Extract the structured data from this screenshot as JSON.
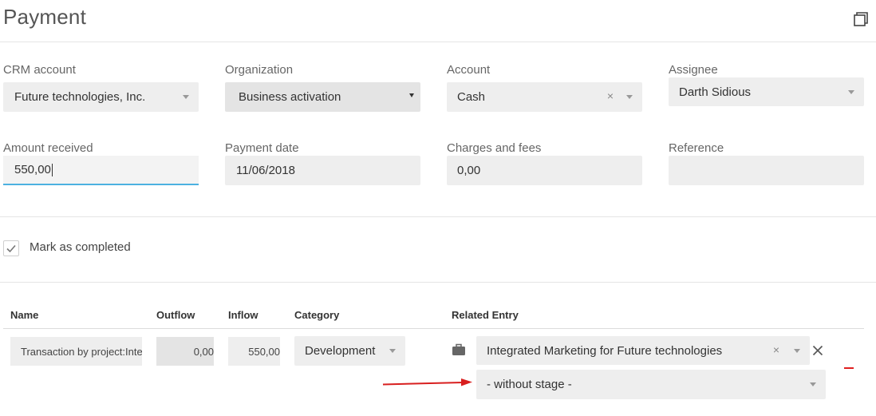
{
  "page": {
    "title": "Payment"
  },
  "fields": {
    "crm_account": {
      "label": "CRM account",
      "value": "Future technologies, Inc."
    },
    "organization": {
      "label": "Organization",
      "value": "Business activation"
    },
    "account": {
      "label": "Account",
      "value": "Cash",
      "clear": "×"
    },
    "assignee": {
      "label": "Assignee",
      "value": "Darth Sidious"
    },
    "amount_received": {
      "label": "Amount received",
      "value": "550,00"
    },
    "payment_date": {
      "label": "Payment date",
      "value": "11/06/2018"
    },
    "charges_fees": {
      "label": "Charges and fees",
      "value": "0,00"
    },
    "reference": {
      "label": "Reference",
      "value": ""
    }
  },
  "mark_completed": {
    "label": "Mark as completed",
    "checked": true
  },
  "table": {
    "headers": {
      "name": "Name",
      "outflow": "Outflow",
      "inflow": "Inflow",
      "category": "Category",
      "related_entry": "Related Entry"
    },
    "rows": [
      {
        "name": "Transaction by project:Integrated Marketing for Future technologies",
        "outflow": "0,00",
        "inflow": "550,00",
        "category": "Development",
        "related_entry": "Integrated Marketing for Future technologies",
        "related_clear": "×",
        "stage": "- without stage -"
      }
    ]
  },
  "colors": {
    "accent": "#4cb1e0",
    "arrow": "#d81f1f",
    "remove": "#e02020"
  }
}
